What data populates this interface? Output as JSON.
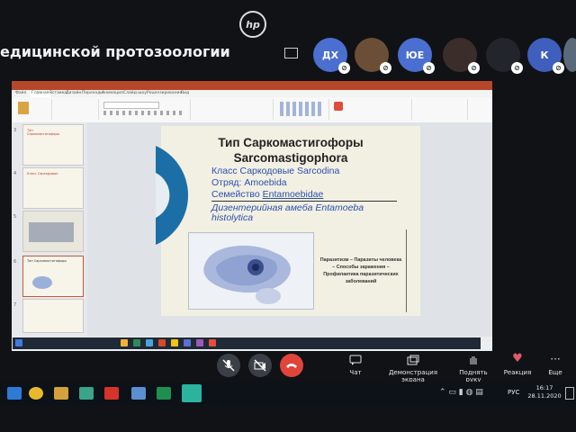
{
  "meeting": {
    "title": "едицинской протозоологии",
    "participants": [
      {
        "initials": "ДХ",
        "color": "#4a6fd0"
      },
      {
        "initials": "",
        "color": "#7a5a3c"
      },
      {
        "initials": "ЮЕ",
        "color": "#4a6fd0"
      },
      {
        "initials": "",
        "color": "#3a2d2a"
      },
      {
        "initials": "",
        "color": "#2b2f36"
      },
      {
        "initials": "К",
        "color": "#4a6fd0"
      },
      {
        "initials": "",
        "color": "#5a6a7a"
      }
    ]
  },
  "powerpoint": {
    "ribbon_tabs": [
      "Файл",
      "Главная",
      "Вставка",
      "Дизайн",
      "Переходы",
      "Анимация",
      "Слайд-шоу",
      "Рецензирование",
      "Вид"
    ],
    "thumbnails": [
      {
        "num": "3",
        "text": "Тип Саркомастигофоры"
      },
      {
        "num": "4",
        "text": "Класс Саркодовые"
      },
      {
        "num": "5",
        "text": ""
      },
      {
        "num": "6",
        "text": "Тип Саркомастигофоры"
      },
      {
        "num": "7",
        "text": ""
      }
    ]
  },
  "slide": {
    "title_line1": "Тип Саркомастигофоры",
    "title_line2": "Sarcomastigophora",
    "class_line": "Класс Саркодовые Sarcodina",
    "order_line": "Отряд: Amoebida",
    "family_label": "Семейство ",
    "family_name": "Entamoebidae",
    "species_label": "Дизентерийная амеба ",
    "species_name_1": "Entamoeba",
    "species_name_2": "histolytica",
    "caption": "Паразитизм – Паразиты человека – Способы заражения – Профилактика паразитических заболеваний"
  },
  "controls": {
    "chat": "Чат",
    "screen_share": "Демонстрация экрана",
    "raise_hand": "Поднять руку",
    "reaction": "Реакция",
    "more": "Еще"
  },
  "taskbar": {
    "language": "РУС",
    "time": "16:17",
    "date": "28.11.2020"
  },
  "colors": {
    "screen_bg": "#eceff2",
    "ppt_accent": "#b7472a",
    "hangup": "#e0453b",
    "heart": "#e05a6a"
  }
}
